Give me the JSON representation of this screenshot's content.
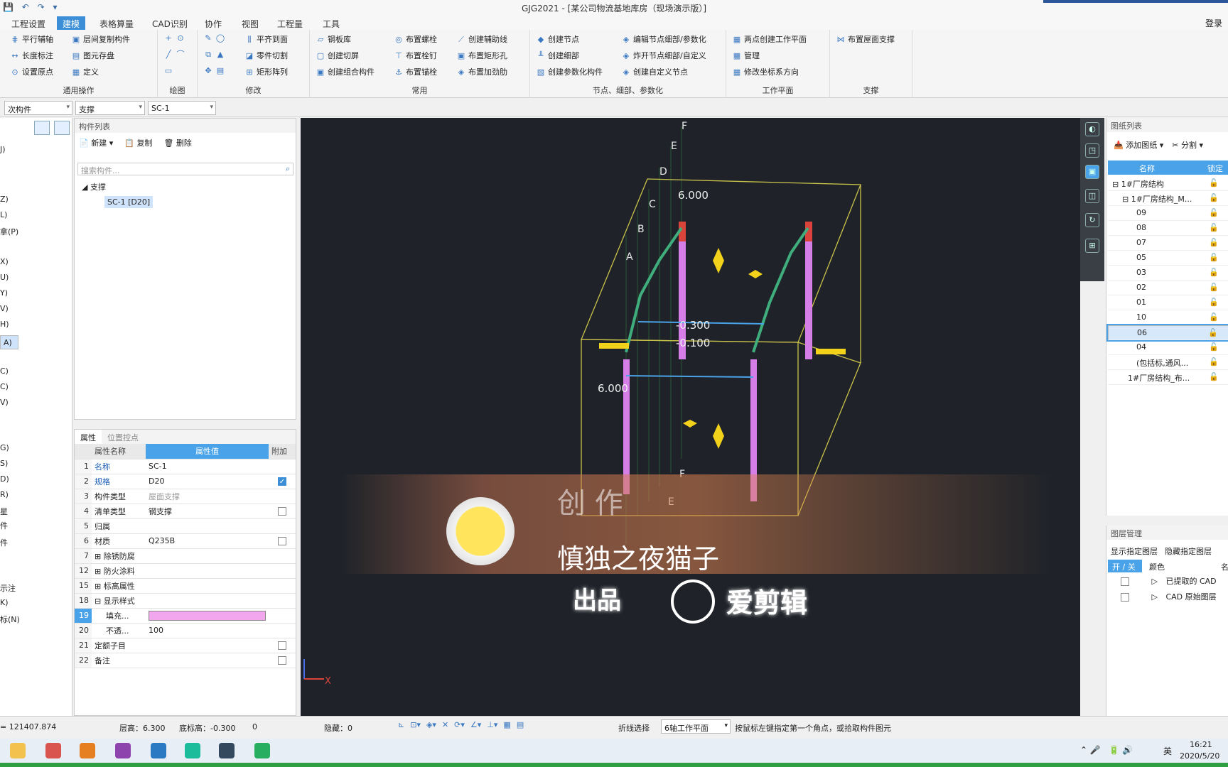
{
  "window": {
    "title": "GJG2021 - [某公司物流基地库房（现场演示版）]",
    "login": "登录"
  },
  "menu": {
    "tabs": [
      "工程设置",
      "建模",
      "表格算量",
      "CAD识别",
      "协作",
      "视图",
      "工程量",
      "工具"
    ]
  },
  "ribbon": {
    "groups": [
      {
        "label": "通用操作",
        "items": [
          "平行辅轴",
          "层间复制构件",
          "长度标注",
          "图元存盘",
          "设置原点",
          "定义"
        ]
      },
      {
        "label": "绘图",
        "items": []
      },
      {
        "label": "修改",
        "items": [
          "平齐到面",
          "零件切割",
          "矩形阵列"
        ]
      },
      {
        "label": "常用",
        "items": [
          "钢板库",
          "创建切屏",
          "创建组合构件",
          "布置螺栓",
          "布置栓钉",
          "布置锚栓",
          "创建辅助线",
          "布置矩形孔",
          "布置加劲肋"
        ]
      },
      {
        "label": "节点、细部、参数化",
        "items": [
          "创建节点",
          "创建细部",
          "创建参数化构件",
          "编辑节点细部/参数化",
          "炸开节点细部/自定义",
          "创建自定义节点"
        ]
      },
      {
        "label": "工作平面",
        "items": [
          "两点创建工作平面",
          "管理",
          "修改坐标系方向"
        ]
      },
      {
        "label": "支撑",
        "items": [
          "布置屋面支撑"
        ]
      }
    ]
  },
  "selectors": {
    "category": "次构件",
    "type": "支撑",
    "name": "SC-1"
  },
  "left_nav": {
    "items": [
      "J)",
      "Z)",
      "L)",
      "拿(P)",
      "X)",
      "U)",
      "Y)",
      "V)",
      "H)",
      "A)",
      "C)",
      "C)",
      "V)",
      "G)",
      "S)",
      "D)",
      "R)",
      "星",
      "件",
      "件",
      "示注",
      "K)",
      "标(N)"
    ]
  },
  "component_list": {
    "title": "构件列表",
    "actions": [
      "新建",
      "复制",
      "删除"
    ],
    "search_placeholder": "搜索构件...",
    "tree_root": "支撑",
    "tree_child": "SC-1 [D20]"
  },
  "properties": {
    "tabs": [
      "属性",
      "位置控点"
    ],
    "headers": [
      "属性名称",
      "属性值",
      "附加"
    ],
    "rows": [
      {
        "num": "1",
        "name": "名称",
        "value": "SC-1",
        "check": ""
      },
      {
        "num": "2",
        "name": "规格",
        "value": "D20",
        "check": "on"
      },
      {
        "num": "3",
        "name": "构件类型",
        "value": "屋面支撑",
        "check": ""
      },
      {
        "num": "4",
        "name": "清单类型",
        "value": "钢支撑",
        "check": "off"
      },
      {
        "num": "5",
        "name": "归属",
        "value": "",
        "check": ""
      },
      {
        "num": "6",
        "name": "材质",
        "value": "Q235B",
        "check": "off"
      },
      {
        "num": "7",
        "name": "除锈防腐",
        "value": "",
        "check": ""
      },
      {
        "num": "12",
        "name": "防火涂料",
        "value": "",
        "check": ""
      },
      {
        "num": "15",
        "name": "标高属性",
        "value": "",
        "check": ""
      },
      {
        "num": "18",
        "name": "显示样式",
        "value": "",
        "check": ""
      },
      {
        "num": "19",
        "name": "填充...",
        "value": "",
        "check": ""
      },
      {
        "num": "20",
        "name": "不透...",
        "value": "100",
        "check": ""
      },
      {
        "num": "21",
        "name": "定额子目",
        "value": "",
        "check": "off"
      },
      {
        "num": "22",
        "name": "备注",
        "value": "",
        "check": "off"
      }
    ],
    "fill_color": "#f2a6ee"
  },
  "viewport": {
    "axis_labels": [
      "F",
      "E",
      "D",
      "C",
      "B",
      "A"
    ],
    "dims": [
      "6.000",
      "6.000",
      "-0.300",
      "-0.100"
    ],
    "lower_labels": [
      "F",
      "E"
    ],
    "axis_x": "X"
  },
  "drawing_list": {
    "title": "图纸列表",
    "actions": [
      "添加图纸",
      "分割"
    ],
    "headers": [
      "名称",
      "锁定"
    ],
    "rows": [
      "1#厂房结构",
      "1#厂房结构_M...",
      "09",
      "08",
      "07",
      "05",
      "03",
      "02",
      "01",
      "10",
      "06",
      "04",
      "(包括标,通风...",
      "1#厂房结构_布..."
    ],
    "selected_index": 10
  },
  "layer_panel": {
    "title": "图层管理",
    "options": [
      "显示指定图层",
      "隐藏指定图层"
    ],
    "headers": [
      "开 / 关",
      "颜色",
      "名"
    ],
    "rows": [
      "已提取的 CAD",
      "CAD 原始图层"
    ]
  },
  "status": {
    "coord": "= 121407.874",
    "floor_height": "层高：6.300",
    "base_elev": "底标高：-0.300",
    "zero": "0",
    "hidden": "隐藏：0",
    "polyline": "折线选择",
    "plane": "6轴工作平面",
    "hint": "按鼠标左键指定第一个角点，或拾取构件图元"
  },
  "taskbar": {
    "time": "16:21",
    "date": "2020/5/20",
    "ime": "英"
  },
  "overlay": {
    "line1": "创 作",
    "line2": "慎独之夜猫子",
    "line3": "出品",
    "line4": "爱剪辑"
  }
}
